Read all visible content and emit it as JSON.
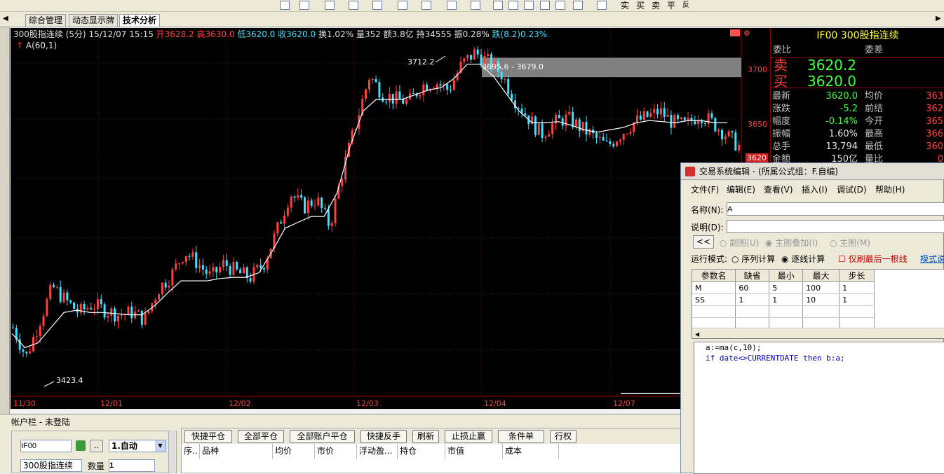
{
  "toolbar": {
    "buttons": [
      "实",
      "买",
      "卖",
      "平",
      "反"
    ]
  },
  "tabs": [
    "综合管理",
    "动态显示牌",
    "技术分析"
  ],
  "chart": {
    "header": {
      "name": "300股指连续 (5分)",
      "date": "15/12/07 15:15",
      "open": "开3628.2",
      "high": "高3630.0",
      "low": "低3620.0",
      "close": "收3620.0",
      "turnover": "换1.02%",
      "volume": "量352",
      "amount": "额3.8亿",
      "open_interest": "持34555",
      "amplitude": "振0.28%",
      "change": "跌(8.2)0.23%"
    },
    "indicator": "A(60,1)",
    "annotations": {
      "high": "3712.2",
      "low": "3423.4",
      "range": "3695.6 - 3679.0"
    },
    "dates": [
      "11/30",
      "12/01",
      "12/02",
      "12/03",
      "12/04",
      "12/07"
    ],
    "price_ticks": [
      "3700",
      "3650",
      "3620"
    ],
    "colors": {
      "up": "#ff4040",
      "down": "#40e0ff",
      "ma": "#ffffff",
      "grid": "#8a0000"
    }
  },
  "chart_data": {
    "type": "candlestick",
    "title": "300股指连续 (5分)",
    "ylim": [
      3410,
      3715
    ],
    "yticks": [
      3700,
      3650
    ],
    "x": [
      "11/30",
      "12/01",
      "12/02",
      "12/03",
      "12/04",
      "12/07"
    ],
    "close_path": [
      3465,
      3440,
      3470,
      3500,
      3488,
      3478,
      3485,
      3480,
      3476,
      3478,
      3472,
      3498,
      3510,
      3530,
      3520,
      3508,
      3520,
      3512,
      3508,
      3520,
      3548,
      3580,
      3568,
      3575,
      3552,
      3600,
      3640,
      3680,
      3665,
      3660,
      3658,
      3672,
      3675,
      3668,
      3690,
      3700,
      3692,
      3682,
      3660,
      3645,
      3630,
      3640,
      3644,
      3636,
      3628,
      3620,
      3630,
      3640,
      3645,
      3650,
      3640,
      3638,
      3648,
      3640,
      3630,
      3620
    ],
    "ma_path": [
      3460,
      3448,
      3452,
      3465,
      3478,
      3480,
      3478,
      3478,
      3477,
      3476,
      3476,
      3484,
      3495,
      3505,
      3505,
      3505,
      3507,
      3508,
      3508,
      3512,
      3530,
      3550,
      3555,
      3560,
      3560,
      3580,
      3620,
      3650,
      3660,
      3660,
      3660,
      3664,
      3668,
      3670,
      3678,
      3690,
      3690,
      3680,
      3665,
      3650,
      3640,
      3640,
      3641,
      3638,
      3634,
      3632,
      3634,
      3636,
      3640,
      3642,
      3641,
      3640,
      3642,
      3642,
      3640,
      3640
    ]
  },
  "rpanel": {
    "title": "IF00  300股指连续",
    "weibi": "委比",
    "weicha": "委差",
    "sell_label": "卖",
    "sell_price": "3620.2",
    "buy_label": "买",
    "buy_price": "3620.0",
    "rows": [
      {
        "l1": "最新",
        "v1": "3620.0",
        "l2": "均价",
        "v2": "363"
      },
      {
        "l1": "涨跌",
        "v1": "-5.2",
        "l2": "前结",
        "v2": "362"
      },
      {
        "l1": "幅度",
        "v1": "-0.14%",
        "l2": "今开",
        "v2": "365"
      },
      {
        "l1": "振幅",
        "v1": "1.60%",
        "l2": "最高",
        "v2": "366"
      },
      {
        "l1": "总手",
        "v1": "13,794",
        "l2": "最低",
        "v2": "360"
      },
      {
        "l1": "金额",
        "v1": "150亿",
        "l2": "量比",
        "v2": "0"
      }
    ]
  },
  "account": {
    "label": "帐户栏  - 未登陆",
    "code": "IF00",
    "ellipsis": "..",
    "mode": "1.自动",
    "name": "300股指连续",
    "qty_label": "数量",
    "qty": "1"
  },
  "actions": [
    "快捷平仓",
    "全部平仓",
    "全部账户平仓",
    "快捷反手",
    "刷新",
    "止损止赢",
    "条件单",
    "行权"
  ],
  "columns": [
    "序..",
    "品种",
    "均价",
    "市价",
    "浮动盈...",
    "持仓",
    "市值",
    "成本"
  ],
  "dialog": {
    "title": "交易系统编辑 - (所属公式组：F.自编)",
    "menus": [
      "文件(F)",
      "编辑(E)",
      "查看(V)",
      "插入(I)",
      "调试(D)",
      "帮助(H)"
    ],
    "name_label": "名称(N):",
    "name_value": "A",
    "desc_label": "说明(D):",
    "back": "<<",
    "opt1": "副图(U)",
    "opt2": "主图叠加(I)",
    "opt3": "主图(M)",
    "run_label": "运行模式:",
    "run1": "序列计算",
    "run2": "逐线计算",
    "last_bar": "仅刷最后一根线",
    "template": "模式说",
    "param_headers": [
      "参数名",
      "缺省",
      "最小",
      "最大",
      "步长"
    ],
    "params": [
      [
        "M",
        "60",
        "5",
        "100",
        "1"
      ],
      [
        "SS",
        "1",
        "1",
        "10",
        "1"
      ]
    ],
    "code_lines": [
      "a:=ma(c,10);",
      "if date<>CURRENTDATE then b:a;"
    ]
  }
}
